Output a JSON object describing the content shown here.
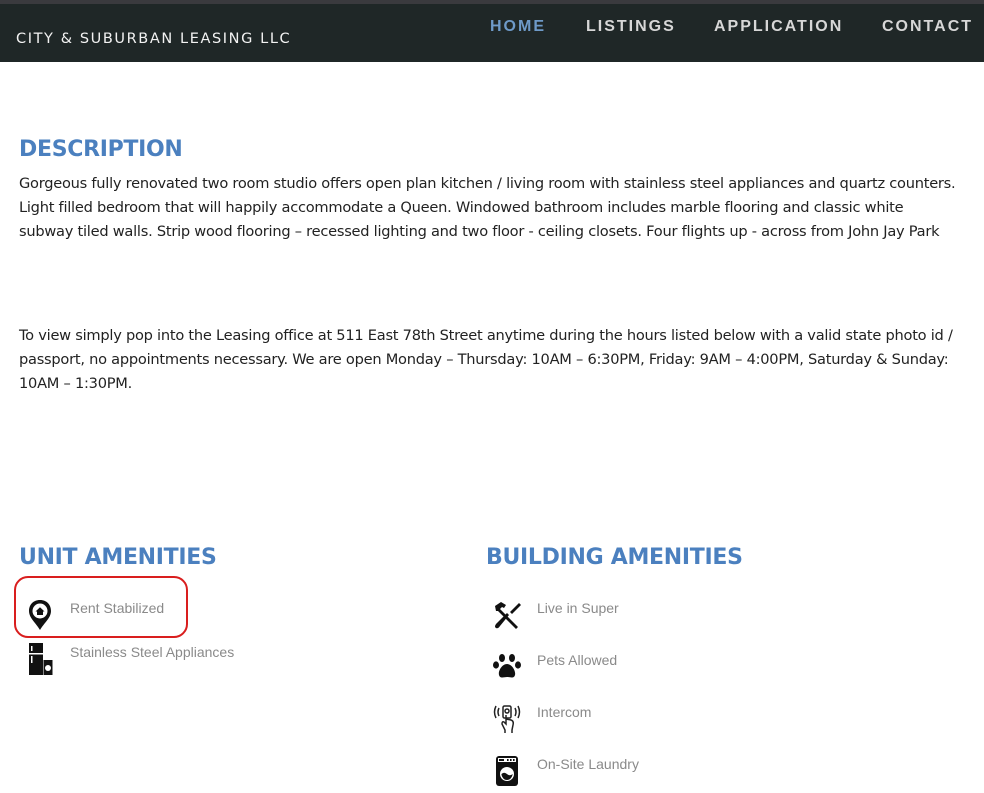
{
  "header": {
    "brand": "CITY & SUBURBAN LEASING LLC",
    "nav": [
      {
        "label": "HOME",
        "active": true
      },
      {
        "label": "LISTINGS",
        "active": false
      },
      {
        "label": "APPLICATION",
        "active": false
      },
      {
        "label": "CONTACT",
        "active": false
      }
    ]
  },
  "description": {
    "title": "DESCRIPTION",
    "text": "Gorgeous fully renovated two room studio offers open plan kitchen / living room with stainless steel appliances and quartz counters. Light filled bedroom that will happily accommodate a Queen. Windowed bathroom includes marble flooring and classic white subway tiled walls. Strip wood flooring – recessed lighting and two floor - ceiling closets. Four flights up - across from John Jay Park",
    "visit_text": "To view simply pop into the Leasing office at 511 East 78th Street anytime during the hours listed below with a valid state photo id / passport, no appointments necessary. We are open Monday – Thursday: 10AM – 6:30PM, Friday: 9AM – 4:00PM, Saturday & Sunday: 10AM – 1:30PM."
  },
  "unit_amenities": {
    "title": "UNIT AMENITIES",
    "items": [
      {
        "label": "Rent Stabilized",
        "icon": "map-pin-home-icon",
        "highlighted": true
      },
      {
        "label": "Stainless Steel Appliances",
        "icon": "fridge-icon",
        "highlighted": false
      }
    ]
  },
  "building_amenities": {
    "title": "BUILDING AMENITIES",
    "items": [
      {
        "label": "Live in Super",
        "icon": "hammer-screwdriver-icon"
      },
      {
        "label": "Pets Allowed",
        "icon": "paw-icon"
      },
      {
        "label": "Intercom",
        "icon": "intercom-button-icon"
      },
      {
        "label": "On-Site Laundry",
        "icon": "washing-machine-icon"
      }
    ]
  },
  "colors": {
    "navbar_bg": "#1f2727",
    "nav_active": "#6e9ac8",
    "heading_blue": "#4b80bf",
    "highlight_red": "#d91e1e"
  }
}
